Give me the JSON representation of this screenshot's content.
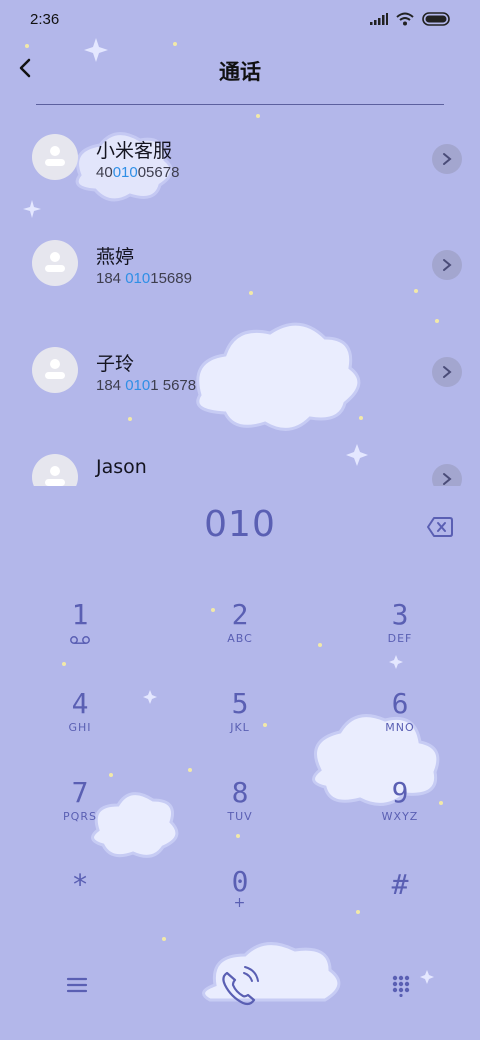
{
  "status": {
    "time": "2:36"
  },
  "header": {
    "title": "通话"
  },
  "contacts": [
    {
      "name": "小米客服",
      "num_pre": "40",
      "num_hl": "010",
      "num_post": "05678"
    },
    {
      "name": "燕婷",
      "num_pre": "184 ",
      "num_hl": "010",
      "num_post": "15689"
    },
    {
      "name": "子玲",
      "num_pre": "184 ",
      "num_hl": "010",
      "num_post": "1 5678"
    },
    {
      "name": "Jason",
      "num_pre": "",
      "num_hl": "",
      "num_post": ""
    }
  ],
  "dialed": "010",
  "keypad": [
    {
      "digit": "1",
      "letters": ""
    },
    {
      "digit": "2",
      "letters": "ABC"
    },
    {
      "digit": "3",
      "letters": "DEF"
    },
    {
      "digit": "4",
      "letters": "GHI"
    },
    {
      "digit": "5",
      "letters": "JKL"
    },
    {
      "digit": "6",
      "letters": "MNO"
    },
    {
      "digit": "7",
      "letters": "PQRS"
    },
    {
      "digit": "8",
      "letters": "TUV"
    },
    {
      "digit": "9",
      "letters": "WXYZ"
    },
    {
      "digit": "*",
      "letters": ""
    },
    {
      "digit": "0",
      "letters": "+"
    },
    {
      "digit": "#",
      "letters": ""
    }
  ],
  "colors": {
    "background": "#b3b7ea",
    "accent": "#5a5fb3",
    "highlight": "#2f8fe6"
  },
  "icons": {
    "back": "chevron-left-icon",
    "delete": "backspace-icon",
    "menu": "menu-icon",
    "call": "phone-icon",
    "keypad": "keypad-icon"
  }
}
